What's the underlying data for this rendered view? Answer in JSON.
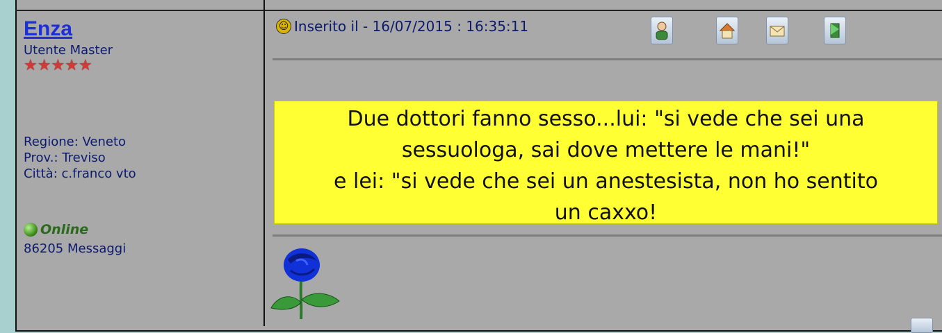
{
  "author": {
    "name": "Enza",
    "rank": "Utente Master",
    "stars": "★★★★★",
    "region": "Regione: Veneto",
    "province": "Prov.: Treviso",
    "city": "Città: c.franco vto",
    "status": "Online",
    "message_count": "86205 Messaggi"
  },
  "post": {
    "posted_label": "Inserito il - 16/07/2015 : 16:35:11",
    "icons": [
      "profile-icon",
      "home-icon",
      "email-icon",
      "bookmark-icon"
    ],
    "text_lines": [
      "Due dottori fanno sesso...lui: \"si vede che sei una",
      "sessuologa, sai dove mettere le mani!\"",
      "e lei: \"si vede che sei un anestesista, non ho sentito",
      "un caxxo!"
    ],
    "highlight_color": "#ffff33"
  }
}
